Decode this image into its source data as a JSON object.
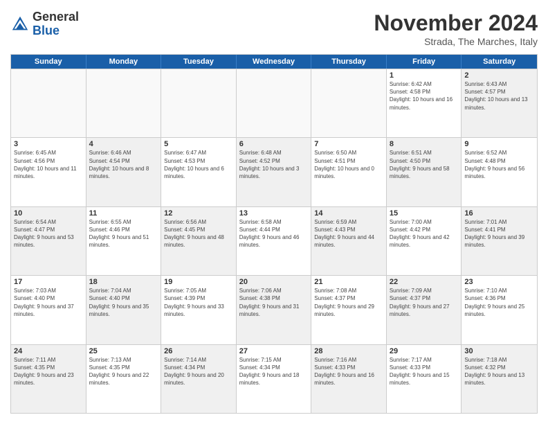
{
  "header": {
    "logo_line1": "General",
    "logo_line2": "Blue",
    "month_title": "November 2024",
    "subtitle": "Strada, The Marches, Italy"
  },
  "calendar": {
    "headers": [
      "Sunday",
      "Monday",
      "Tuesday",
      "Wednesday",
      "Thursday",
      "Friday",
      "Saturday"
    ],
    "rows": [
      [
        {
          "day": "",
          "empty": true
        },
        {
          "day": "",
          "empty": true
        },
        {
          "day": "",
          "empty": true
        },
        {
          "day": "",
          "empty": true
        },
        {
          "day": "",
          "empty": true
        },
        {
          "day": "1",
          "sunrise": "6:42 AM",
          "sunset": "4:58 PM",
          "daylight": "10 hours and 16 minutes.",
          "shaded": false
        },
        {
          "day": "2",
          "sunrise": "6:43 AM",
          "sunset": "4:57 PM",
          "daylight": "10 hours and 13 minutes.",
          "shaded": true
        }
      ],
      [
        {
          "day": "3",
          "sunrise": "6:45 AM",
          "sunset": "4:56 PM",
          "daylight": "10 hours and 11 minutes.",
          "shaded": false
        },
        {
          "day": "4",
          "sunrise": "6:46 AM",
          "sunset": "4:54 PM",
          "daylight": "10 hours and 8 minutes.",
          "shaded": true
        },
        {
          "day": "5",
          "sunrise": "6:47 AM",
          "sunset": "4:53 PM",
          "daylight": "10 hours and 6 minutes.",
          "shaded": false
        },
        {
          "day": "6",
          "sunrise": "6:48 AM",
          "sunset": "4:52 PM",
          "daylight": "10 hours and 3 minutes.",
          "shaded": true
        },
        {
          "day": "7",
          "sunrise": "6:50 AM",
          "sunset": "4:51 PM",
          "daylight": "10 hours and 0 minutes.",
          "shaded": false
        },
        {
          "day": "8",
          "sunrise": "6:51 AM",
          "sunset": "4:50 PM",
          "daylight": "9 hours and 58 minutes.",
          "shaded": true
        },
        {
          "day": "9",
          "sunrise": "6:52 AM",
          "sunset": "4:48 PM",
          "daylight": "9 hours and 56 minutes.",
          "shaded": false
        }
      ],
      [
        {
          "day": "10",
          "sunrise": "6:54 AM",
          "sunset": "4:47 PM",
          "daylight": "9 hours and 53 minutes.",
          "shaded": true
        },
        {
          "day": "11",
          "sunrise": "6:55 AM",
          "sunset": "4:46 PM",
          "daylight": "9 hours and 51 minutes.",
          "shaded": false
        },
        {
          "day": "12",
          "sunrise": "6:56 AM",
          "sunset": "4:45 PM",
          "daylight": "9 hours and 48 minutes.",
          "shaded": true
        },
        {
          "day": "13",
          "sunrise": "6:58 AM",
          "sunset": "4:44 PM",
          "daylight": "9 hours and 46 minutes.",
          "shaded": false
        },
        {
          "day": "14",
          "sunrise": "6:59 AM",
          "sunset": "4:43 PM",
          "daylight": "9 hours and 44 minutes.",
          "shaded": true
        },
        {
          "day": "15",
          "sunrise": "7:00 AM",
          "sunset": "4:42 PM",
          "daylight": "9 hours and 42 minutes.",
          "shaded": false
        },
        {
          "day": "16",
          "sunrise": "7:01 AM",
          "sunset": "4:41 PM",
          "daylight": "9 hours and 39 minutes.",
          "shaded": true
        }
      ],
      [
        {
          "day": "17",
          "sunrise": "7:03 AM",
          "sunset": "4:40 PM",
          "daylight": "9 hours and 37 minutes.",
          "shaded": false
        },
        {
          "day": "18",
          "sunrise": "7:04 AM",
          "sunset": "4:40 PM",
          "daylight": "9 hours and 35 minutes.",
          "shaded": true
        },
        {
          "day": "19",
          "sunrise": "7:05 AM",
          "sunset": "4:39 PM",
          "daylight": "9 hours and 33 minutes.",
          "shaded": false
        },
        {
          "day": "20",
          "sunrise": "7:06 AM",
          "sunset": "4:38 PM",
          "daylight": "9 hours and 31 minutes.",
          "shaded": true
        },
        {
          "day": "21",
          "sunrise": "7:08 AM",
          "sunset": "4:37 PM",
          "daylight": "9 hours and 29 minutes.",
          "shaded": false
        },
        {
          "day": "22",
          "sunrise": "7:09 AM",
          "sunset": "4:37 PM",
          "daylight": "9 hours and 27 minutes.",
          "shaded": true
        },
        {
          "day": "23",
          "sunrise": "7:10 AM",
          "sunset": "4:36 PM",
          "daylight": "9 hours and 25 minutes.",
          "shaded": false
        }
      ],
      [
        {
          "day": "24",
          "sunrise": "7:11 AM",
          "sunset": "4:35 PM",
          "daylight": "9 hours and 23 minutes.",
          "shaded": true
        },
        {
          "day": "25",
          "sunrise": "7:13 AM",
          "sunset": "4:35 PM",
          "daylight": "9 hours and 22 minutes.",
          "shaded": false
        },
        {
          "day": "26",
          "sunrise": "7:14 AM",
          "sunset": "4:34 PM",
          "daylight": "9 hours and 20 minutes.",
          "shaded": true
        },
        {
          "day": "27",
          "sunrise": "7:15 AM",
          "sunset": "4:34 PM",
          "daylight": "9 hours and 18 minutes.",
          "shaded": false
        },
        {
          "day": "28",
          "sunrise": "7:16 AM",
          "sunset": "4:33 PM",
          "daylight": "9 hours and 16 minutes.",
          "shaded": true
        },
        {
          "day": "29",
          "sunrise": "7:17 AM",
          "sunset": "4:33 PM",
          "daylight": "9 hours and 15 minutes.",
          "shaded": false
        },
        {
          "day": "30",
          "sunrise": "7:18 AM",
          "sunset": "4:32 PM",
          "daylight": "9 hours and 13 minutes.",
          "shaded": true
        }
      ]
    ]
  }
}
